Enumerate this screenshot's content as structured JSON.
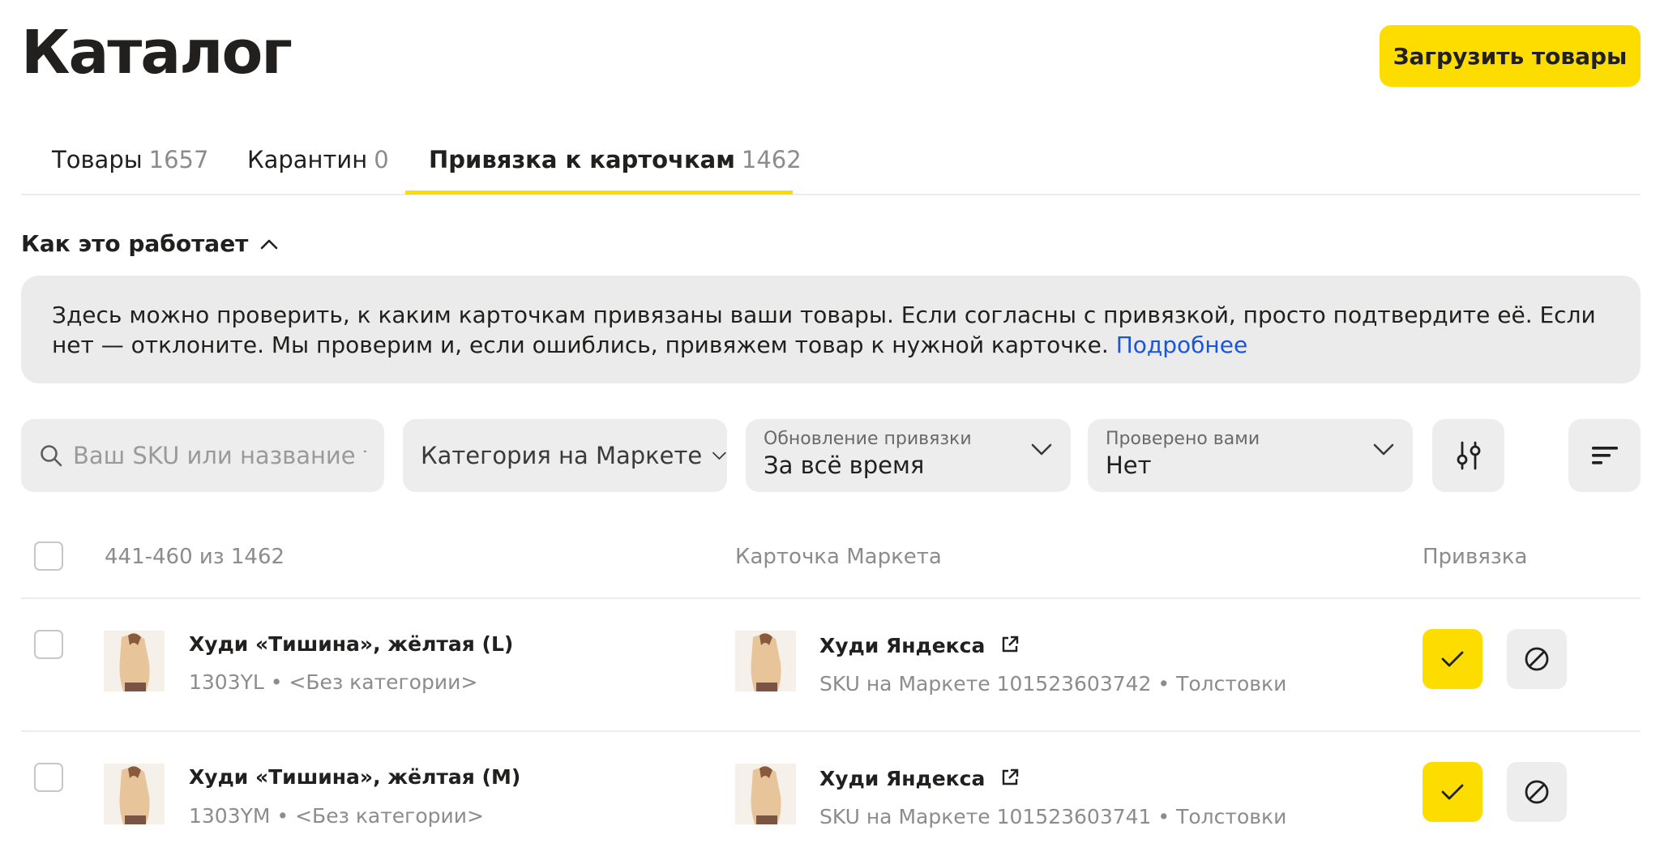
{
  "header": {
    "title": "Каталог",
    "upload_label": "Загрузить товары"
  },
  "tabs": [
    {
      "label": "Товары",
      "count": "1657",
      "active": false
    },
    {
      "label": "Карантин",
      "count": "0",
      "active": false
    },
    {
      "label": "Привязка к карточкам",
      "count": "1462",
      "active": true
    }
  ],
  "how_it_works": {
    "label": "Как это работает",
    "text": "Здесь можно проверить, к каким карточкам привязаны ваши товары. Если согласны с привязкой, просто подтвердите её. Если нет — отклоните. Мы проверим и, если ошиблись, привяжем товар к нужной карточке.",
    "link": "Подробнее"
  },
  "filters": {
    "search_placeholder": "Ваш SKU или название товара",
    "category": "Категория на Маркете",
    "update": {
      "label": "Обновление привязки",
      "value": "За всё время"
    },
    "checked": {
      "label": "Проверено вами",
      "value": "Нет"
    }
  },
  "table": {
    "range": "441-460 из 1462",
    "col_card": "Карточка Маркета",
    "col_binding": "Привязка",
    "rows": [
      {
        "name": "Худи «Тишина», жёлтая (L)",
        "meta": "1303YL • <Без категории>",
        "card_name": "Худи Яндекса",
        "card_meta": "SKU на Маркете 101523603742 • Толстовки"
      },
      {
        "name": "Худи «Тишина», жёлтая (M)",
        "meta": "1303YM • <Без категории>",
        "card_name": "Худи Яндекса",
        "card_meta": "SKU на Маркете 101523603741 • Толстовки"
      }
    ]
  },
  "colors": {
    "accent": "#fddd00",
    "link": "#1a56d8",
    "control_bg": "#ededed"
  }
}
